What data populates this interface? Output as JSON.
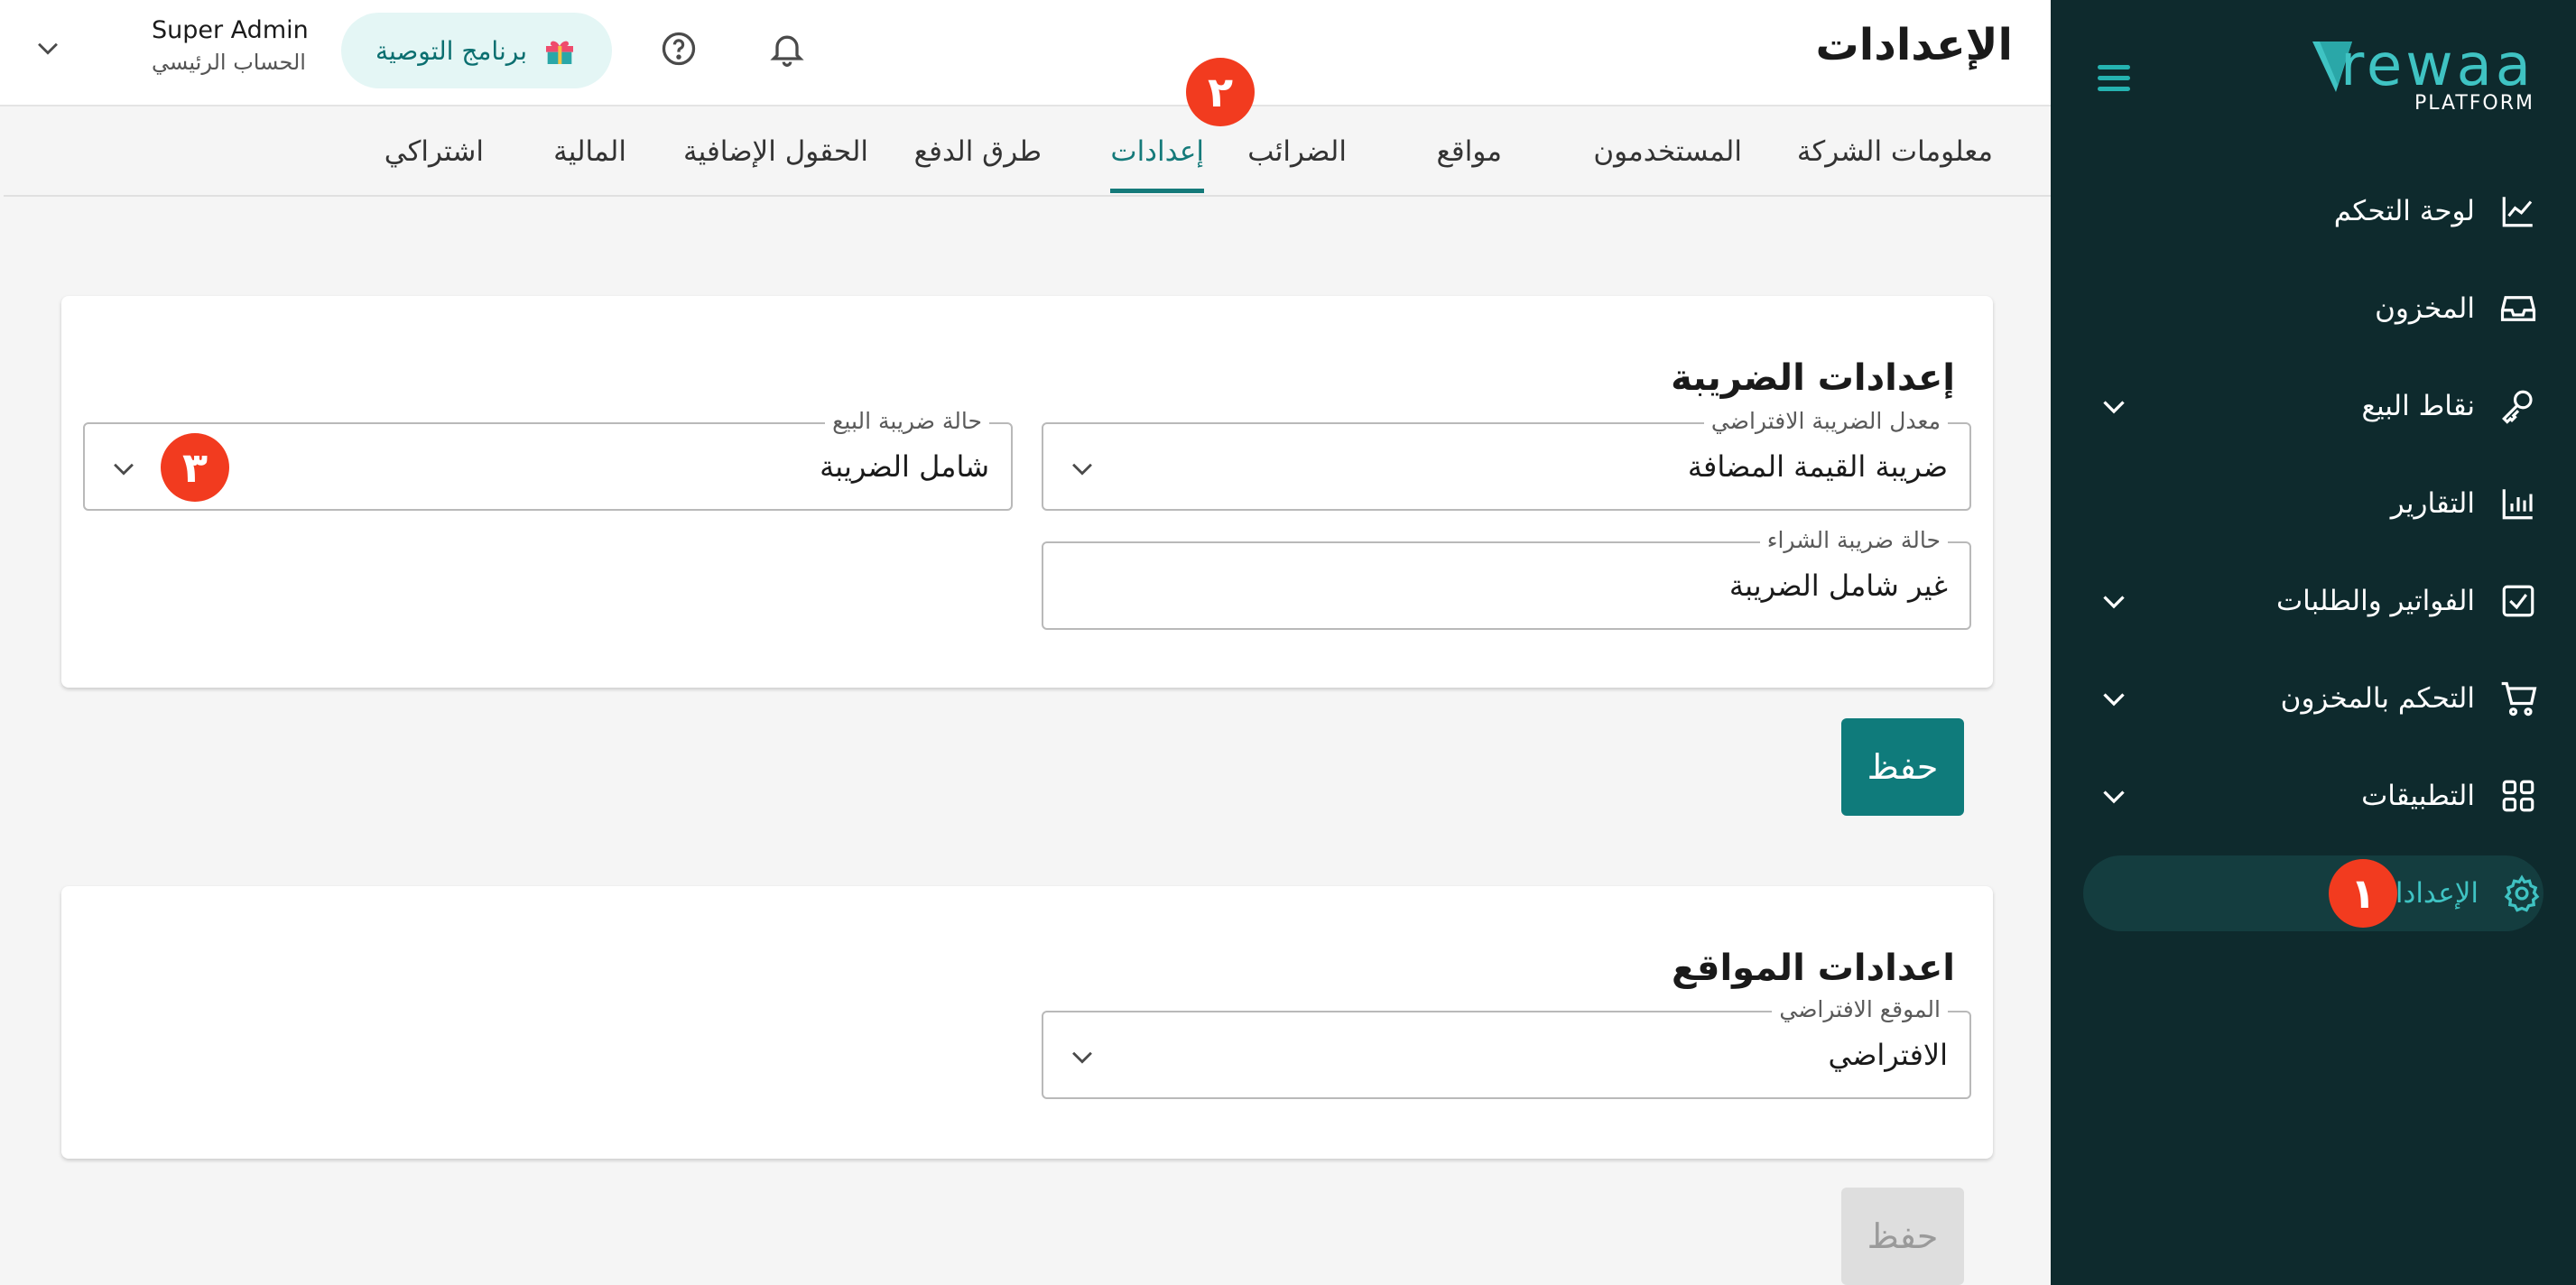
{
  "sidebar": {
    "logo_word": "rewaa",
    "logo_sub": "PLATFORM",
    "items": [
      {
        "label": "لوحة التحكم",
        "icon": "chart-line-icon"
      },
      {
        "label": "المخزون",
        "icon": "inbox-icon"
      },
      {
        "label": "نقاط البيع",
        "icon": "key-icon"
      },
      {
        "label": "التقارير",
        "icon": "bar-chart-icon"
      },
      {
        "label": "الفواتير والطلبات",
        "icon": "checkbox-icon"
      },
      {
        "label": "التحكم بالمخزون",
        "icon": "cart-icon"
      },
      {
        "label": "التطبيقات",
        "icon": "grid-icon"
      },
      {
        "label": "الإعدادات",
        "icon": "gear-icon"
      }
    ],
    "active_badge": "١"
  },
  "header": {
    "title": "الإعدادات",
    "user_name": "Super Admin",
    "user_role": "الحساب الرئيسي",
    "referral_label": "برنامج التوصية"
  },
  "tabs": [
    {
      "label": "معلومات الشركة"
    },
    {
      "label": "المستخدمون"
    },
    {
      "label": "مواقع"
    },
    {
      "label": "الضرائب"
    },
    {
      "label": "إعدادات"
    },
    {
      "label": "طرق الدفع"
    },
    {
      "label": "الحقول الإضافية"
    },
    {
      "label": "المالية"
    },
    {
      "label": "اشتراكي"
    }
  ],
  "tab_badge": "٢",
  "tax_settings": {
    "title": "إعدادات الضريبة",
    "default_rate_label": "معدل الضريبة الافتراضي",
    "default_rate_value": "ضريبة القيمة المضافة",
    "sales_tax_label": "حالة ضريبة البيع",
    "sales_tax_value": "شامل الضريبة",
    "purchase_tax_label": "حالة ضريبة الشراء",
    "purchase_tax_value": "غير شامل الضريبة",
    "field_badge": "٣",
    "save_label": "حفظ"
  },
  "location_settings": {
    "title": "اعدادات المواقع",
    "default_location_label": "الموقع الافتراضي",
    "default_location_value": "الافتراضي",
    "save_label": "حفظ"
  },
  "colors": {
    "sidebar_bg": "#0e2a2d",
    "accent": "#0f7b7b",
    "badge": "#f23b1f"
  }
}
